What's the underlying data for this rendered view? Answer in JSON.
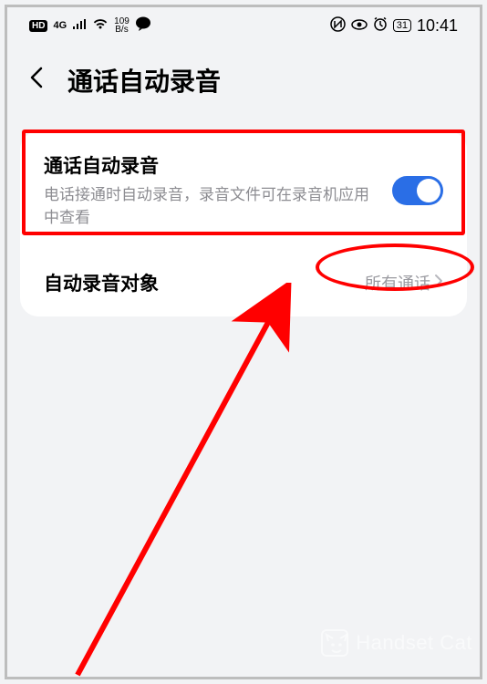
{
  "status": {
    "hd": "HD",
    "net_speed_top": "109",
    "net_speed_bottom": "B/s",
    "battery": "31",
    "time": "10:41"
  },
  "header": {
    "title": "通话自动录音"
  },
  "settings": {
    "auto_record": {
      "title": "通话自动录音",
      "subtitle": "电话接通时自动录音，录音文件可在录音机应用中查看",
      "enabled": true
    },
    "target": {
      "title": "自动录音对象",
      "value": "所有通话"
    }
  },
  "watermark": "Handset Cat"
}
